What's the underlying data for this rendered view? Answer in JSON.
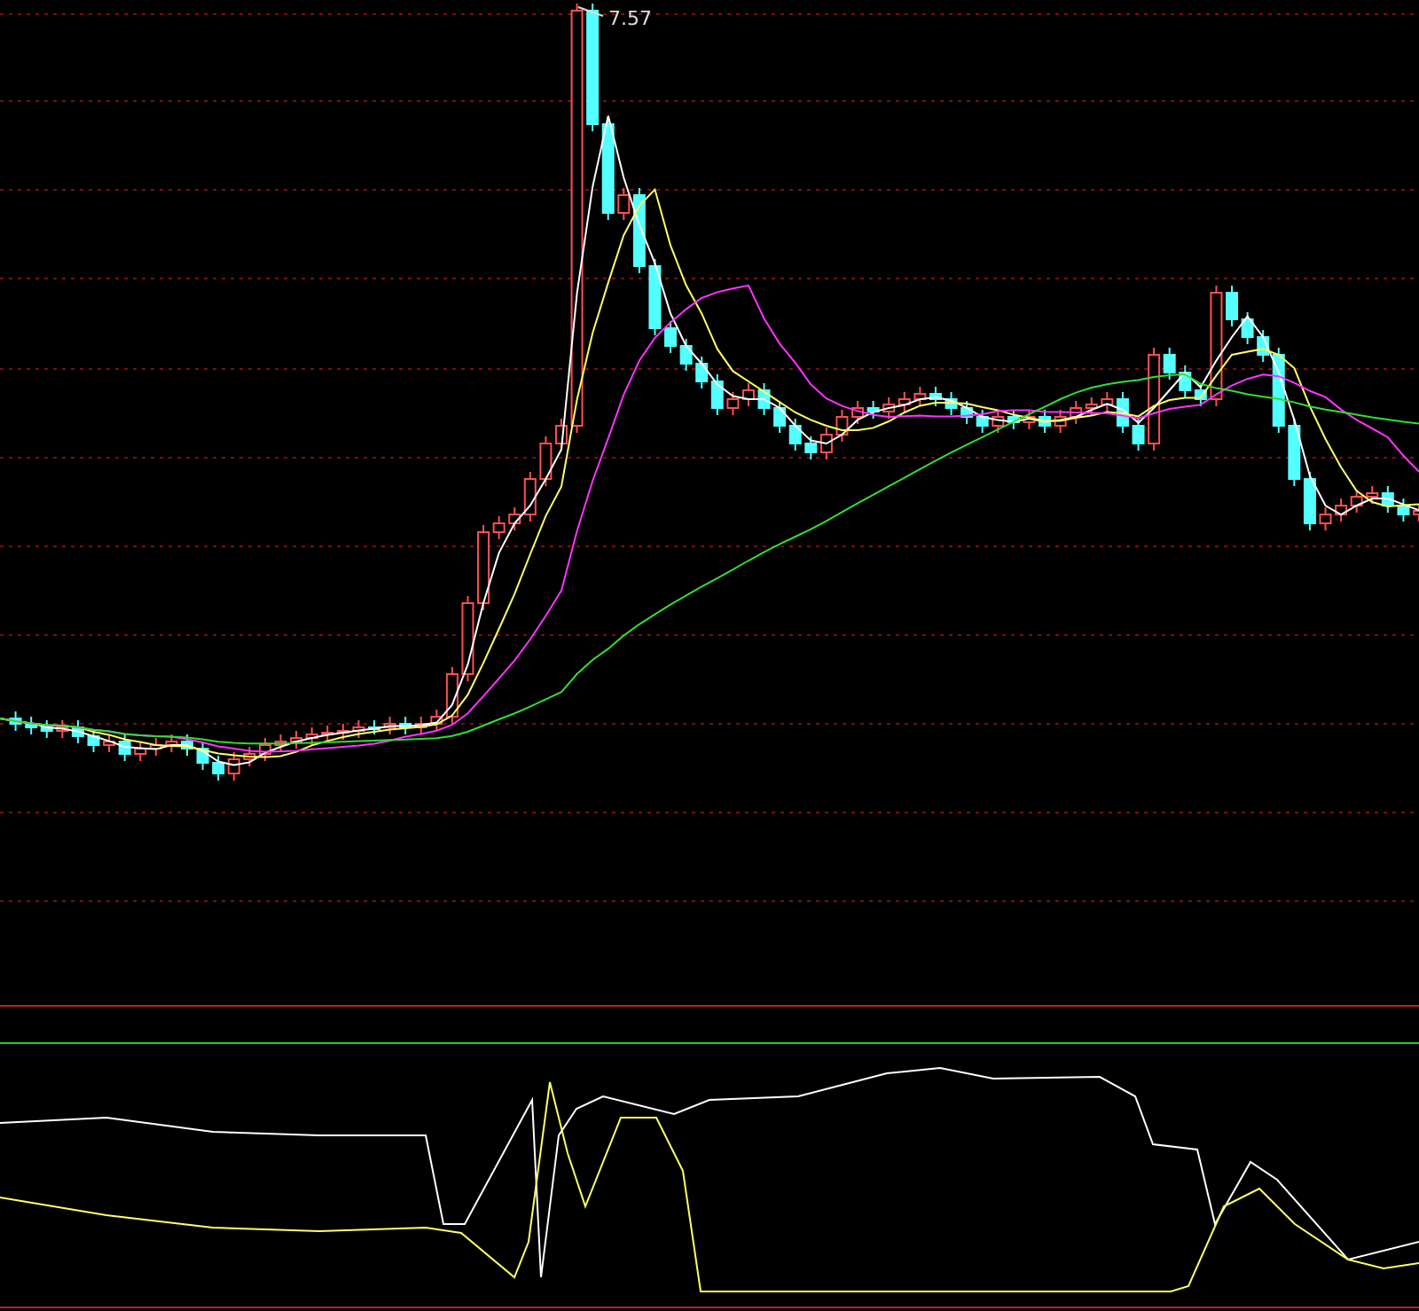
{
  "price_chart": {
    "high_label": "7.57"
  }
}
